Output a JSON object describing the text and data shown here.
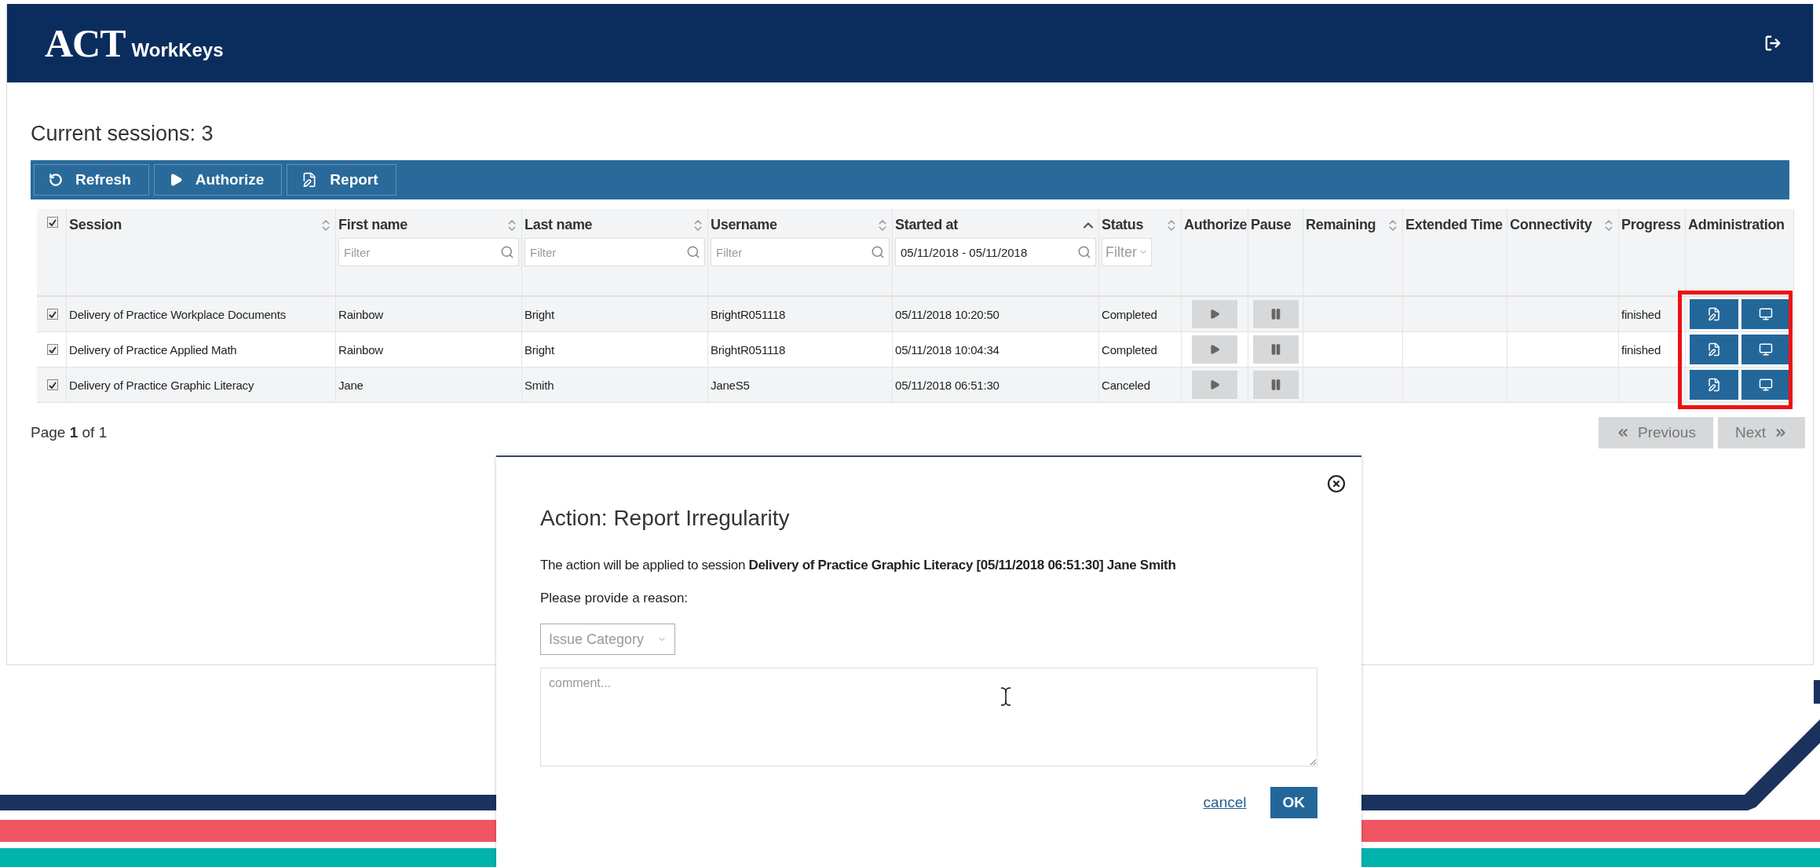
{
  "header": {
    "logo": "ACT",
    "product": "WorkKeys"
  },
  "title": "Current sessions: 3",
  "toolbar": [
    {
      "kind": "refresh",
      "label": "Refresh"
    },
    {
      "kind": "authorize",
      "label": "Authorize"
    },
    {
      "kind": "report",
      "label": "Report"
    }
  ],
  "table": {
    "all_checked": true,
    "columns": [
      {
        "label": "Session",
        "sortable": true,
        "sorted": false
      },
      {
        "label": "First name",
        "sortable": true,
        "sorted": false,
        "filter": {
          "kind": "text",
          "placeholder": "Filter"
        }
      },
      {
        "label": "Last name",
        "sortable": true,
        "sorted": false,
        "filter": {
          "kind": "text",
          "placeholder": "Filter"
        }
      },
      {
        "label": "Username",
        "sortable": true,
        "sorted": false,
        "filter": {
          "kind": "text",
          "placeholder": "Filter"
        }
      },
      {
        "label": "Started at",
        "sortable": true,
        "sorted": true,
        "filter": {
          "kind": "text",
          "value": "05/11/2018 - 05/11/2018"
        }
      },
      {
        "label": "Status",
        "sortable": true,
        "sorted": false,
        "filter": {
          "kind": "select",
          "placeholder": "Filter"
        }
      },
      {
        "label": "Authorize"
      },
      {
        "label": "Pause"
      },
      {
        "label": "Remaining",
        "sortable": true,
        "sorted": false
      },
      {
        "label": "Extended Time"
      },
      {
        "label": "Connectivity",
        "sortable": true,
        "sorted": false
      },
      {
        "label": "Progress"
      },
      {
        "label": "Administration"
      }
    ],
    "rows": [
      {
        "checked": true,
        "session": "Delivery of Practice Workplace Documents",
        "first_name": "Rainbow",
        "last_name": "Bright",
        "username": "BrightR051118",
        "started_at": "05/11/2018 10:20:50",
        "status": "Completed",
        "controls_disabled": true,
        "progress": "finished"
      },
      {
        "checked": true,
        "session": "Delivery of Practice Applied Math",
        "first_name": "Rainbow",
        "last_name": "Bright",
        "username": "BrightR051118",
        "started_at": "05/11/2018 10:04:34",
        "status": "Completed",
        "controls_disabled": true,
        "progress": "finished"
      },
      {
        "checked": true,
        "session": "Delivery of Practice Graphic Literacy",
        "first_name": "Jane",
        "last_name": "Smith",
        "username": "JaneS5",
        "started_at": "05/11/2018 06:51:30",
        "status": "Canceled",
        "controls_disabled": true
      }
    ]
  },
  "pagination": {
    "text": "Page **1** of 1",
    "previous": {
      "label": "Previous",
      "disabled": true
    },
    "next": {
      "label": "Next",
      "disabled": true
    }
  },
  "modal": {
    "title": "Action: Report Irregularity",
    "message": "The action will be applied to session **Delivery of Practice Graphic Literacy [05/11/2018 06:51:30] Jane Smith**",
    "prompt": "Please provide a reason:",
    "category": {
      "placeholder": "Issue Category"
    },
    "comment": {
      "placeholder": "comment..."
    },
    "cancel": "cancel",
    "ok": "OK"
  }
}
